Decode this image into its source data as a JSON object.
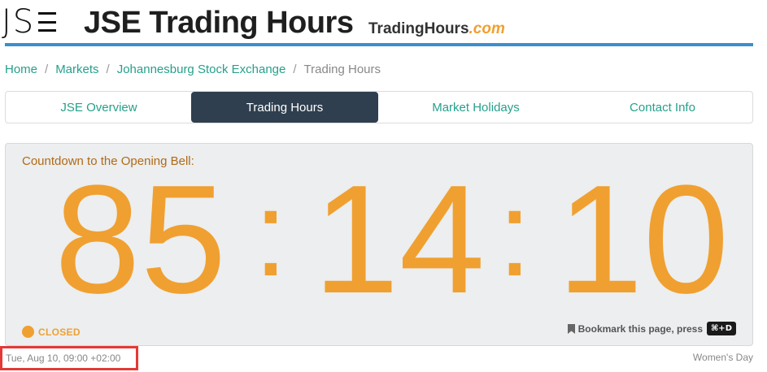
{
  "header": {
    "logo_text": "JS",
    "title": "JSE Trading Hours",
    "brand_main": "TradingHours",
    "brand_suffix": ".com",
    "accent_color": "#3a8fcb"
  },
  "breadcrumb": [
    {
      "label": "Home"
    },
    {
      "label": "Markets"
    },
    {
      "label": "Johannesburg Stock Exchange"
    },
    {
      "label": "Trading Hours"
    }
  ],
  "breadcrumb_separator": "/",
  "tabs": [
    {
      "label": "JSE Overview",
      "active": false
    },
    {
      "label": "Trading Hours",
      "active": true
    },
    {
      "label": "Market Holidays",
      "active": false
    },
    {
      "label": "Contact Info",
      "active": false
    }
  ],
  "countdown": {
    "label": "Countdown to the Opening Bell:",
    "hours": "85",
    "minutes": "14",
    "seconds": "10",
    "separator": ":",
    "color": "#f0a030"
  },
  "status": {
    "label": "CLOSED",
    "icon": "status-dot-icon"
  },
  "bookmark": {
    "text": "Bookmark this page, press",
    "shortcut": "⌘+D",
    "icon": "bookmark-icon"
  },
  "footer": {
    "next_open": "Tue, Aug 10, 09:00 +02:00",
    "holiday": "Women's Day"
  }
}
